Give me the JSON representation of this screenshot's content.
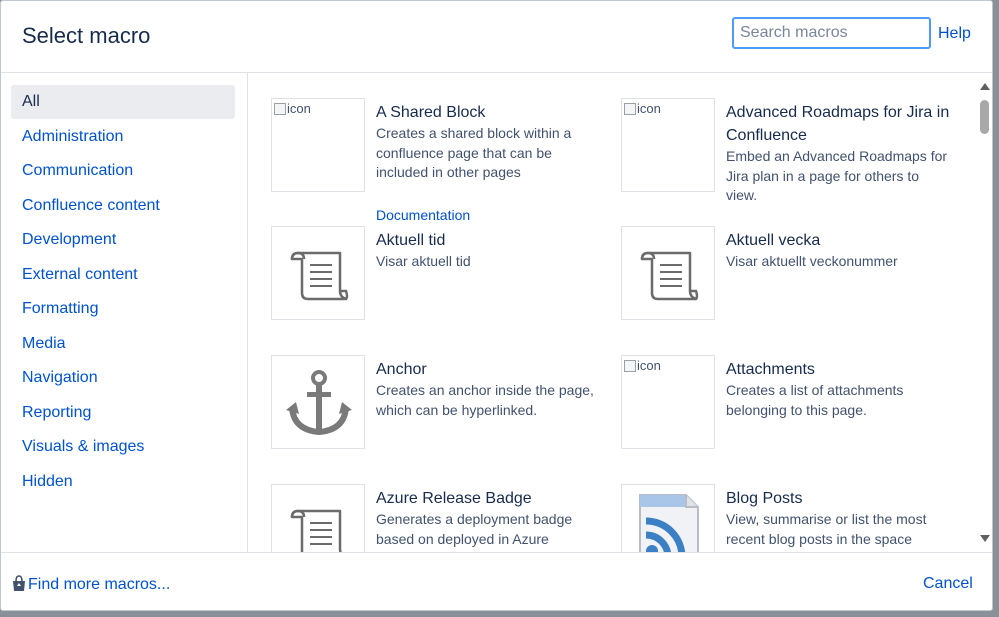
{
  "dialog": {
    "title": "Select macro",
    "search_placeholder": "Search macros",
    "help_label": "Help"
  },
  "sidebar": {
    "items": [
      {
        "label": "All",
        "active": true
      },
      {
        "label": "Administration"
      },
      {
        "label": "Communication"
      },
      {
        "label": "Confluence content"
      },
      {
        "label": "Development"
      },
      {
        "label": "External content"
      },
      {
        "label": "Formatting"
      },
      {
        "label": "Media"
      },
      {
        "label": "Navigation"
      },
      {
        "label": "Reporting"
      },
      {
        "label": "Visuals & images"
      },
      {
        "label": "Hidden"
      }
    ]
  },
  "macros": [
    {
      "name": "A Shared Block",
      "icon": "broken-image",
      "alt": "icon",
      "description": "Creates a shared block within a confluence page that can be included in other pages",
      "link": "Documentation"
    },
    {
      "name": "Advanced Roadmaps for Jira in Confluence",
      "icon": "broken-image",
      "alt": "icon",
      "description": "Embed an Advanced Roadmaps for Jira plan in a page for others to view."
    },
    {
      "name": "Aktuell tid",
      "icon": "scroll-icon",
      "description": "Visar aktuell tid"
    },
    {
      "name": "Aktuell vecka",
      "icon": "scroll-icon",
      "description": "Visar aktuellt veckonummer"
    },
    {
      "name": "Anchor",
      "icon": "anchor-icon",
      "description": "Creates an anchor inside the page, which can be hyperlinked."
    },
    {
      "name": "Attachments",
      "icon": "broken-image",
      "alt": "icon",
      "description": "Creates a list of attachments belonging to this page."
    },
    {
      "name": "Azure Release Badge",
      "icon": "scroll-icon",
      "description": "Generates a deployment badge based on deployed in Azure"
    },
    {
      "name": "Blog Posts",
      "icon": "rss-document-icon",
      "description": "View, summarise or list the most recent blog posts in the space"
    }
  ],
  "footer": {
    "find_more_label": "Find more macros...",
    "cancel_label": "Cancel"
  },
  "colors": {
    "link": "#0052cc",
    "text": "#172b4d",
    "muted": "#42526e",
    "focus": "#4c9aff",
    "active_bg": "#ebecf0"
  }
}
